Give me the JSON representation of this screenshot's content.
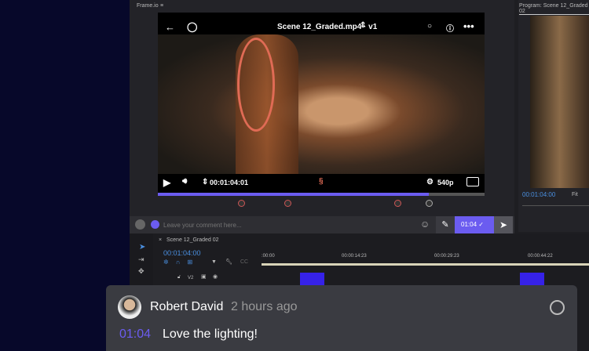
{
  "frameio_panel": {
    "title": "Frame.io"
  },
  "program": {
    "title": "Program: Scene 12_Graded 02",
    "timecode": "00:01:04:00",
    "fit": "Fit"
  },
  "viewer": {
    "file": "Scene 12_Graded.mp4 · v1",
    "timecode": "00:01:04:01",
    "quality": "540p",
    "progress_percent": 83
  },
  "comment_bar": {
    "placeholder": "Leave your comment here...",
    "time_chip": "01:04"
  },
  "timeline": {
    "sequence": "Scene 12_Graded 02",
    "timecode": "00:01:04:00",
    "ruler": [
      ":00:00",
      "00:00:14:23",
      "00:00:29:23",
      "00:00:44:22"
    ],
    "track": "V2"
  },
  "comment": {
    "author": "Robert David",
    "time_ago": "2 hours ago",
    "timestamp": "01:04",
    "text": "Love the lighting!"
  },
  "colors": {
    "accent": "#6b5cf0",
    "clip": "#3622e8",
    "timecode": "#4a8fe0"
  }
}
